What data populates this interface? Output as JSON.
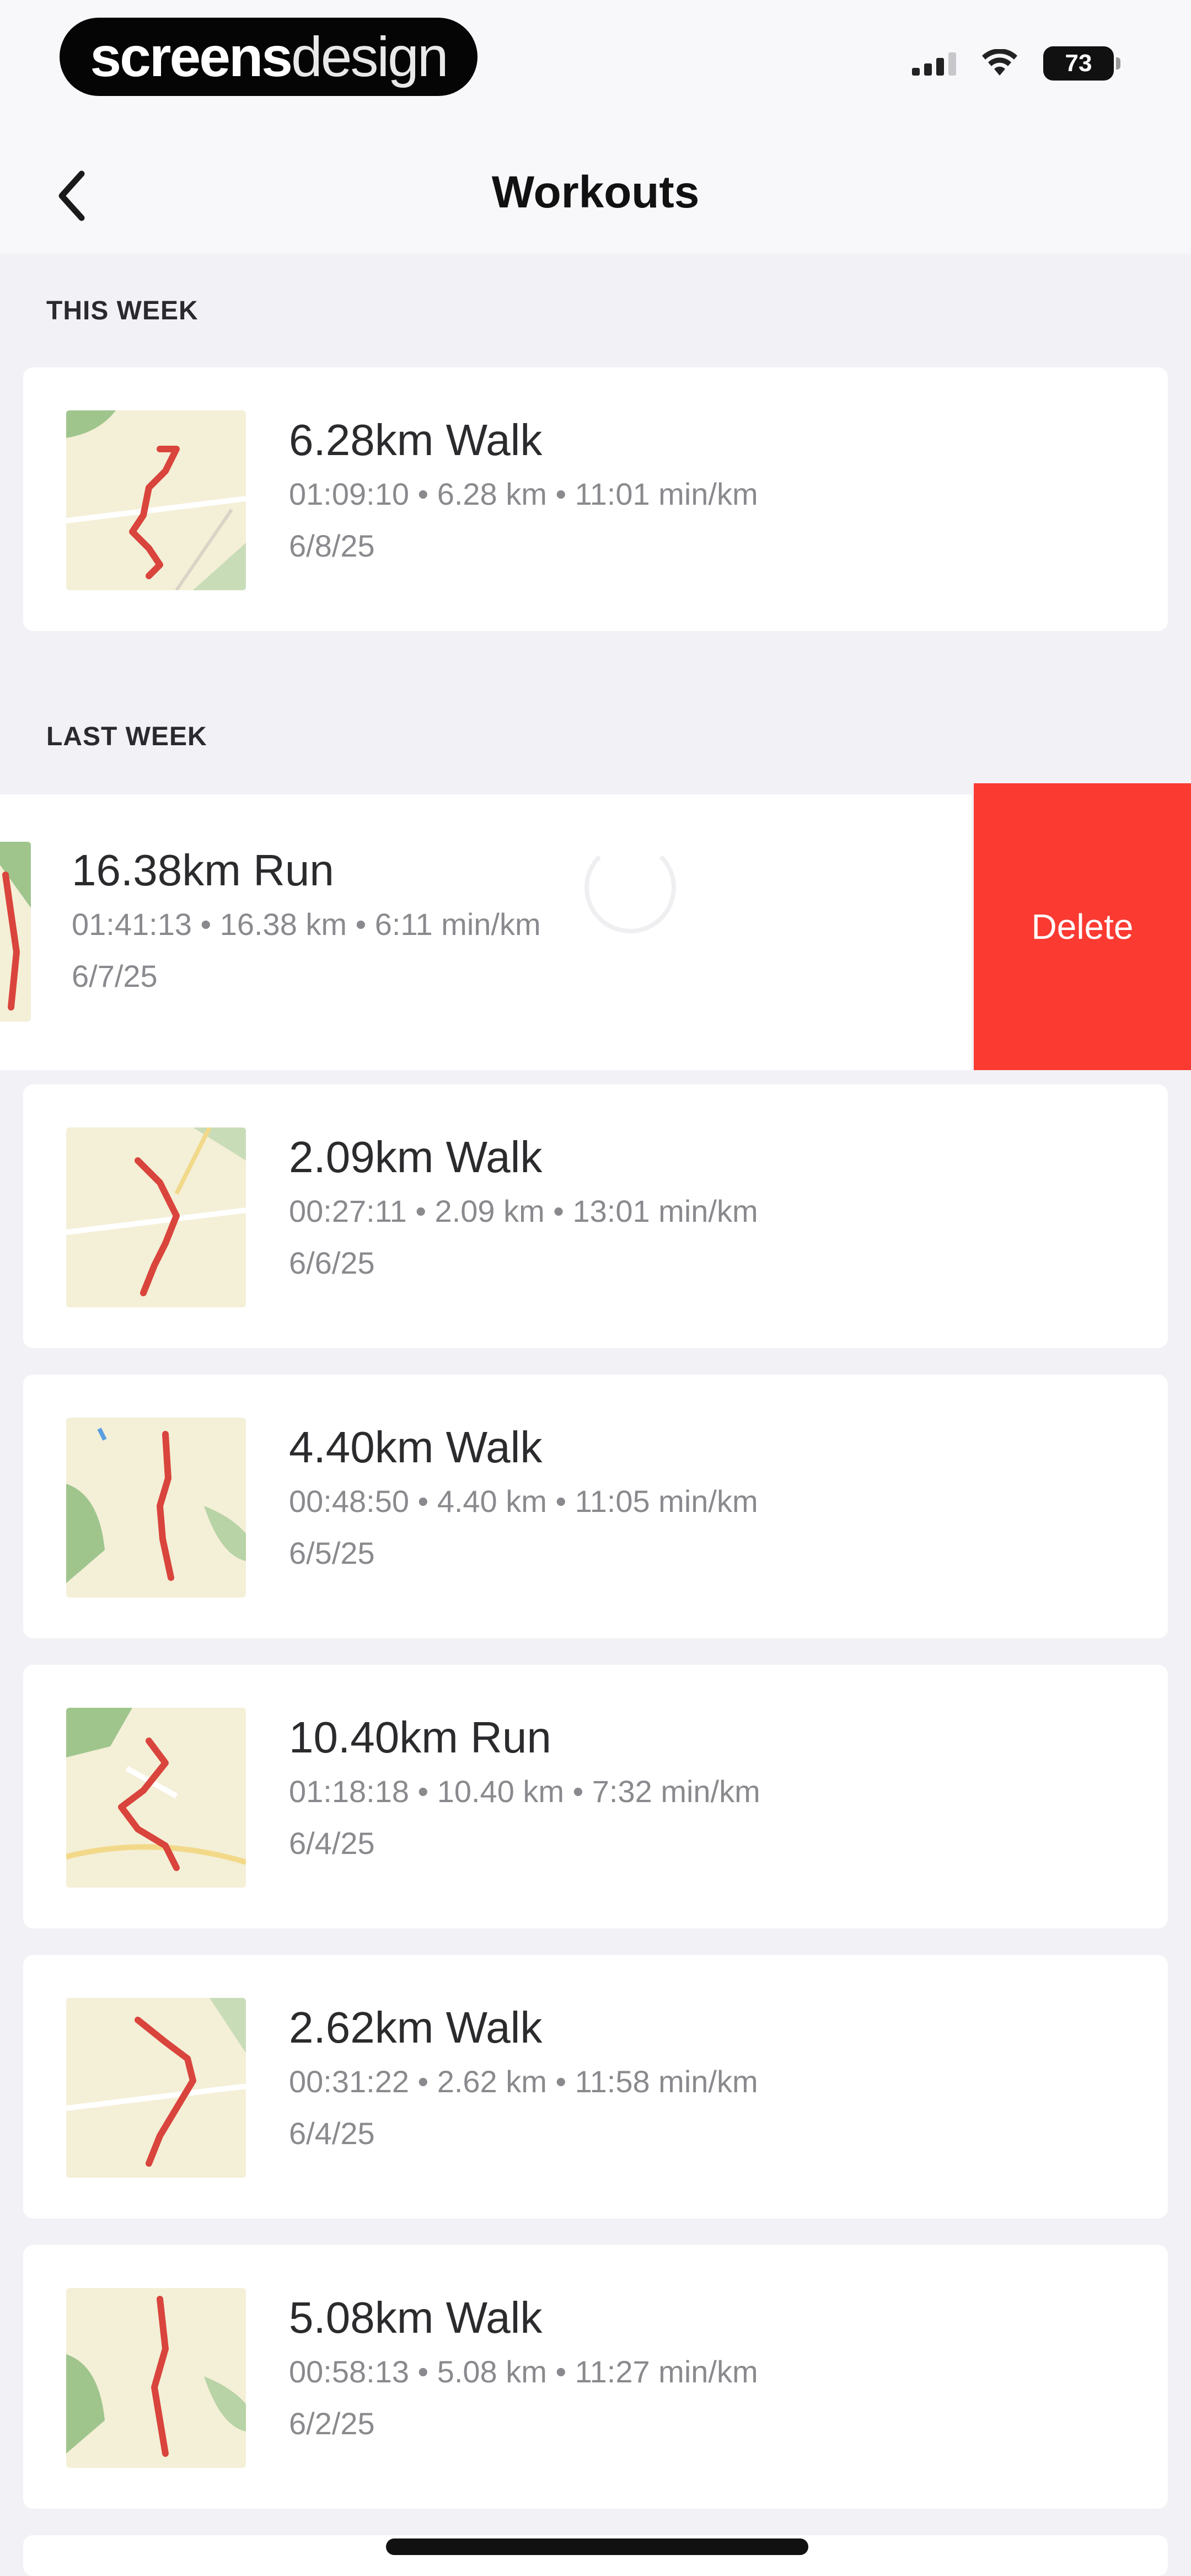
{
  "status_bar": {
    "brand_bold": "screens",
    "brand_light": "design",
    "battery": "73",
    "icons": [
      "signal-icon",
      "wifi-icon",
      "battery-icon"
    ]
  },
  "nav": {
    "title": "Workouts",
    "back_icon": "chevron-left-icon"
  },
  "sections": {
    "this_week": "THIS WEEK",
    "last_week": "LAST WEEK"
  },
  "swipe_action": {
    "label": "Delete",
    "color": "#fb3a32"
  },
  "workouts": [
    {
      "title": "6.28km Walk",
      "stats": "01:09:10 • 6.28 km • 11:01 min/km",
      "date": "6/8/25"
    },
    {
      "title": "16.38km Run",
      "stats": "01:41:13 • 16.38 km • 6:11 min/km",
      "date": "6/7/25"
    },
    {
      "title": "2.09km Walk",
      "stats": "00:27:11 • 2.09 km • 13:01 min/km",
      "date": "6/6/25"
    },
    {
      "title": "4.40km Walk",
      "stats": "00:48:50 • 4.40 km • 11:05 min/km",
      "date": "6/5/25"
    },
    {
      "title": "10.40km Run",
      "stats": "01:18:18 • 10.40 km • 7:32 min/km",
      "date": "6/4/25"
    },
    {
      "title": "2.62km Walk",
      "stats": "00:31:22 • 2.62 km • 11:58 min/km",
      "date": "6/4/25"
    },
    {
      "title": "5.08km Walk",
      "stats": "00:58:13 • 5.08 km • 11:27 min/km",
      "date": "6/2/25"
    }
  ],
  "colors": {
    "background": "#f2f1f6",
    "card": "#ffffff",
    "route": "#d9443c",
    "map_land": "#f4efd7",
    "map_park": "#9fc58d"
  }
}
